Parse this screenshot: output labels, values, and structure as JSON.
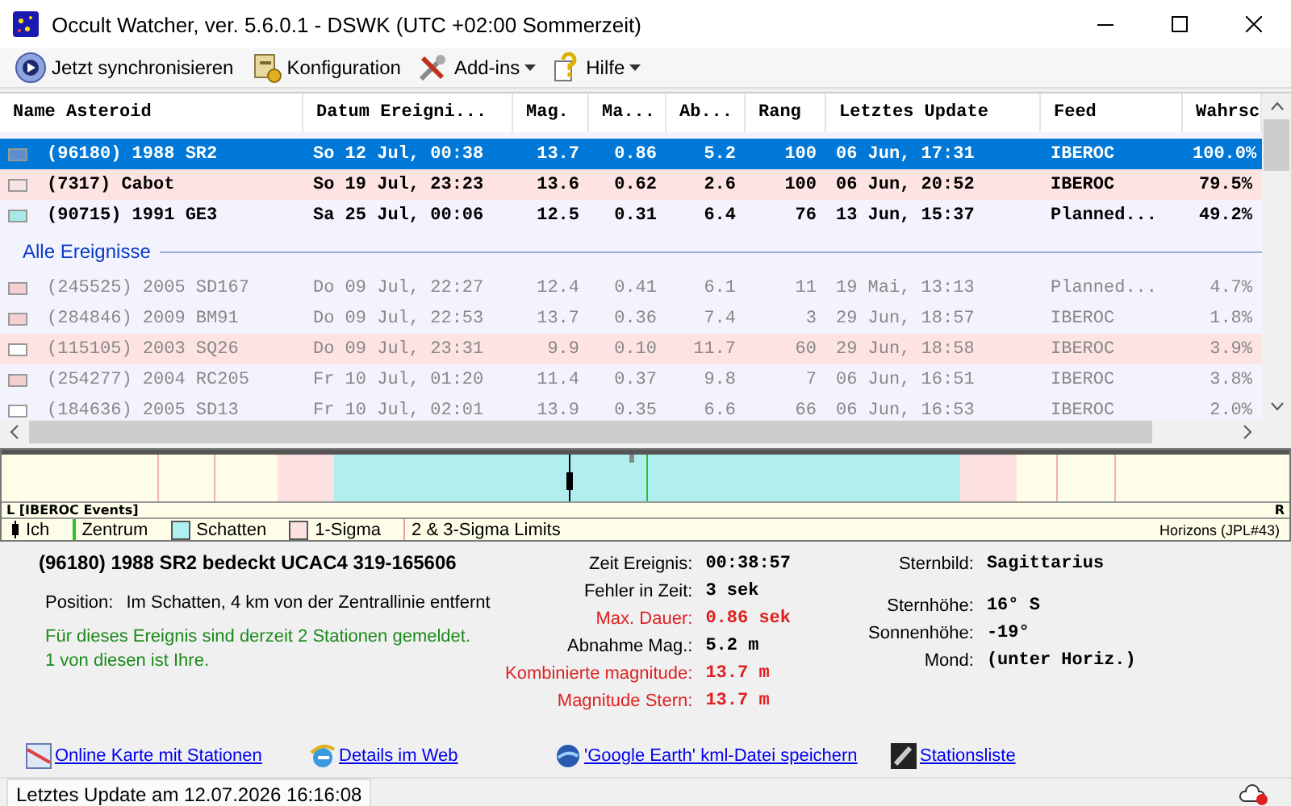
{
  "window": {
    "title": "Occult Watcher, ver. 5.6.0.1 - DSWK (UTC +02:00 Sommerzeit)"
  },
  "toolbar": [
    {
      "label": "Jetzt synchronisieren",
      "kind": "sync",
      "dropdown": false
    },
    {
      "label": "Konfiguration",
      "kind": "config",
      "dropdown": false
    },
    {
      "label": "Add-ins",
      "kind": "tools",
      "dropdown": true
    },
    {
      "label": "Hilfe",
      "kind": "help",
      "dropdown": true
    }
  ],
  "table": {
    "columns": [
      "Name Asteroid",
      "Datum Ereigni...",
      "Mag.",
      "Ma...",
      "Ab...",
      "Rang",
      "Letztes Update",
      "Feed",
      "Wahrsc"
    ],
    "groups": [
      {
        "dimmed": false,
        "rows": [
          {
            "selected": true,
            "highlighted": false,
            "color": "#5b8fd0",
            "cells": [
              "(96180) 1988 SR2",
              "So 12 Jul, 00:38",
              "13.7",
              "0.86",
              "5.2",
              "100",
              "06 Jun, 17:31",
              "IBEROC",
              "100.0%"
            ]
          },
          {
            "selected": false,
            "highlighted": true,
            "color": "#f6e4e4",
            "cells": [
              "(7317) Cabot",
              "So 19 Jul, 23:23",
              "13.6",
              "0.62",
              "2.6",
              "100",
              "06 Jun, 20:52",
              "IBEROC",
              "79.5%"
            ]
          },
          {
            "selected": false,
            "highlighted": false,
            "color": "#a8e8e8",
            "cells": [
              "(90715) 1991 GE3",
              "Sa 25 Jul, 00:06",
              "12.5",
              "0.31",
              "6.4",
              "76",
              "13 Jun, 15:37",
              "Planned...",
              "49.2%"
            ]
          }
        ]
      },
      {
        "label": "Alle Ereignisse",
        "dimmed": true,
        "rows": [
          {
            "selected": false,
            "highlighted": false,
            "color": "#f5d0d0",
            "cells": [
              "(245525) 2005 SD167",
              "Do 09 Jul, 22:27",
              "12.4",
              "0.41",
              "6.1",
              "11",
              "19 Mai, 13:13",
              "Planned...",
              "4.7%"
            ]
          },
          {
            "selected": false,
            "highlighted": false,
            "color": "#f5d0d0",
            "cells": [
              "(284846) 2009 BM91",
              "Do 09 Jul, 22:53",
              "13.7",
              "0.36",
              "7.4",
              "3",
              "29 Jun, 18:57",
              "IBEROC",
              "1.8%"
            ]
          },
          {
            "selected": false,
            "highlighted": true,
            "color": "#ffffff",
            "cells": [
              "(115105) 2003 SQ26",
              "Do 09 Jul, 23:31",
              "9.9",
              "0.10",
              "11.7",
              "60",
              "29 Jun, 18:58",
              "IBEROC",
              "3.9%"
            ]
          },
          {
            "selected": false,
            "highlighted": false,
            "color": "#f5d0d0",
            "cells": [
              "(254277) 2004 RC205",
              "Fr 10 Jul, 01:20",
              "11.4",
              "0.37",
              "9.8",
              "7",
              "06 Jun, 16:51",
              "IBEROC",
              "3.8%"
            ]
          },
          {
            "selected": false,
            "highlighted": false,
            "color": "#ffffff",
            "cells": [
              "(184636) 2005 SD13",
              "Fr 10 Jul, 02:01",
              "13.9",
              "0.35",
              "6.6",
              "66",
              "06 Jun, 16:53",
              "IBEROC",
              "2.0%"
            ]
          }
        ]
      }
    ]
  },
  "timeline": {
    "left_label": "L [IBEROC Events]",
    "right_label": "R",
    "source": "Horizons (JPL#43)",
    "legend": [
      {
        "kind": "observer",
        "label": "Ich"
      },
      {
        "kind": "center",
        "label": "Zentrum"
      },
      {
        "kind": "shadow",
        "label": "Schatten"
      },
      {
        "kind": "sigma",
        "label": "1-Sigma"
      },
      {
        "kind": "limit",
        "label": "2 & 3-Sigma Limits"
      }
    ]
  },
  "details": {
    "title": "(96180) 1988 SR2 bedeckt UCAC4 319-165606",
    "position_label": "Position:",
    "position": "Im Schatten, 4 km von der Zentrallinie entfernt",
    "note": [
      "Für dieses Ereignis sind derzeit 2 Stationen gemeldet.",
      "1 von diesen ist Ihre."
    ],
    "timing": [
      {
        "label": "Zeit Ereignis:",
        "value": "00:38:57",
        "alert": false
      },
      {
        "label": "Fehler in Zeit:",
        "value": "3 sek",
        "alert": false
      },
      {
        "label": "Max. Dauer:",
        "value": "0.86 sek",
        "alert": true
      },
      {
        "label": "Abnahme Mag.:",
        "value": "5.2 m",
        "alert": false
      },
      {
        "label": "Kombinierte magnitude:",
        "value": "13.7 m",
        "alert": true
      },
      {
        "label": "Magnitude Stern:",
        "value": "13.7 m",
        "alert": true
      }
    ],
    "sky": [
      {
        "label": "Sternbild:",
        "value": "Sagittarius"
      },
      {
        "label": "Sternhöhe:",
        "value": "16° S"
      },
      {
        "label": "Sonnenhöhe:",
        "value": "-19°"
      },
      {
        "label": "Mond:",
        "value": "(unter Horiz.)"
      }
    ],
    "links": [
      {
        "kind": "map",
        "label": "Online Karte mit Stationen"
      },
      {
        "kind": "web",
        "label": "Details im Web"
      },
      {
        "kind": "globe",
        "label": "'Google Earth' kml-Datei speichern"
      },
      {
        "kind": "list",
        "label": "Stationsliste"
      }
    ]
  },
  "status_bar": {
    "text": "Letztes Update am 12.07.2026 16:16:08"
  }
}
